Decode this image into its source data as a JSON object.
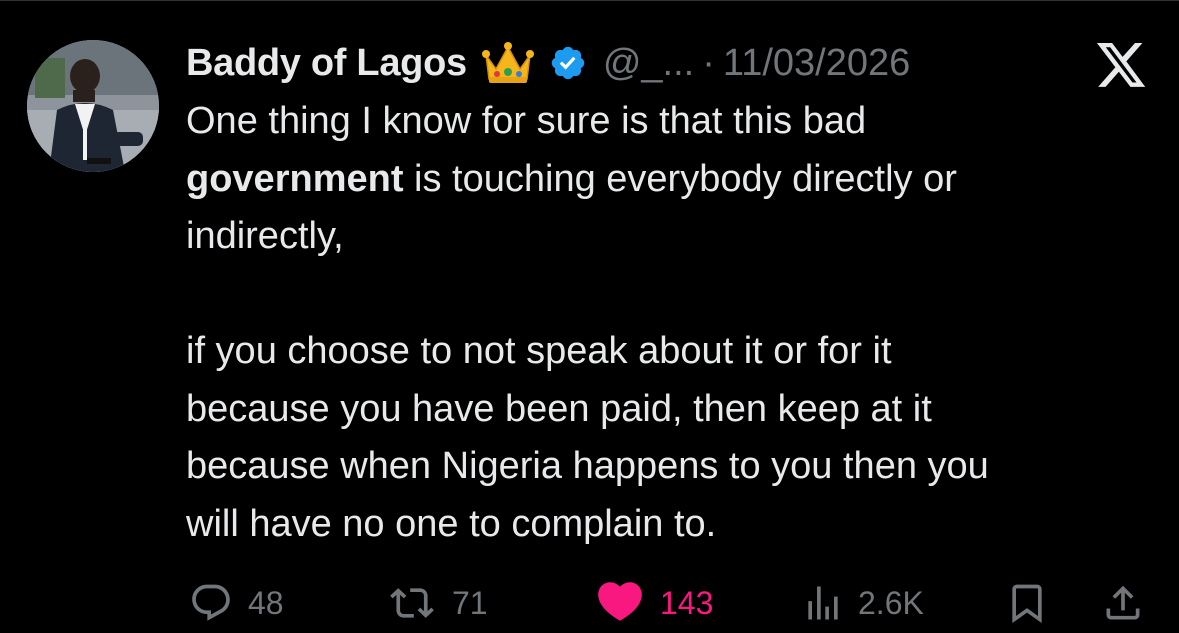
{
  "post": {
    "author_name": "Baddy of Lagos",
    "author_emoji": "crown",
    "verified": true,
    "handle": "@_...",
    "separator": "·",
    "date": "11/03/2026",
    "text": {
      "line1": "One thing I know for sure is that this bad",
      "bold_word": "government",
      "line2_rest": " is touching everybody directly or",
      "line3": "indirectly,",
      "p2_line1": "if you choose to not speak about it or for it",
      "p2_line2": "because you have been paid, then keep at it",
      "p2_line3": "because when Nigeria happens to you then you",
      "p2_line4": "will have no one to complain to."
    }
  },
  "actions": {
    "replies": "48",
    "reposts": "71",
    "likes": "143",
    "views": "2.6K"
  },
  "icons": {
    "platform_logo": "x-logo-icon",
    "reply": "reply-icon",
    "repost": "repost-icon",
    "like": "heart-icon",
    "views": "views-icon",
    "bookmark": "bookmark-icon",
    "share": "share-icon"
  },
  "colors": {
    "background": "#000000",
    "text": "#e7e9ea",
    "muted": "#71767b",
    "like": "#f91880",
    "verified": "#1d9bf0"
  }
}
